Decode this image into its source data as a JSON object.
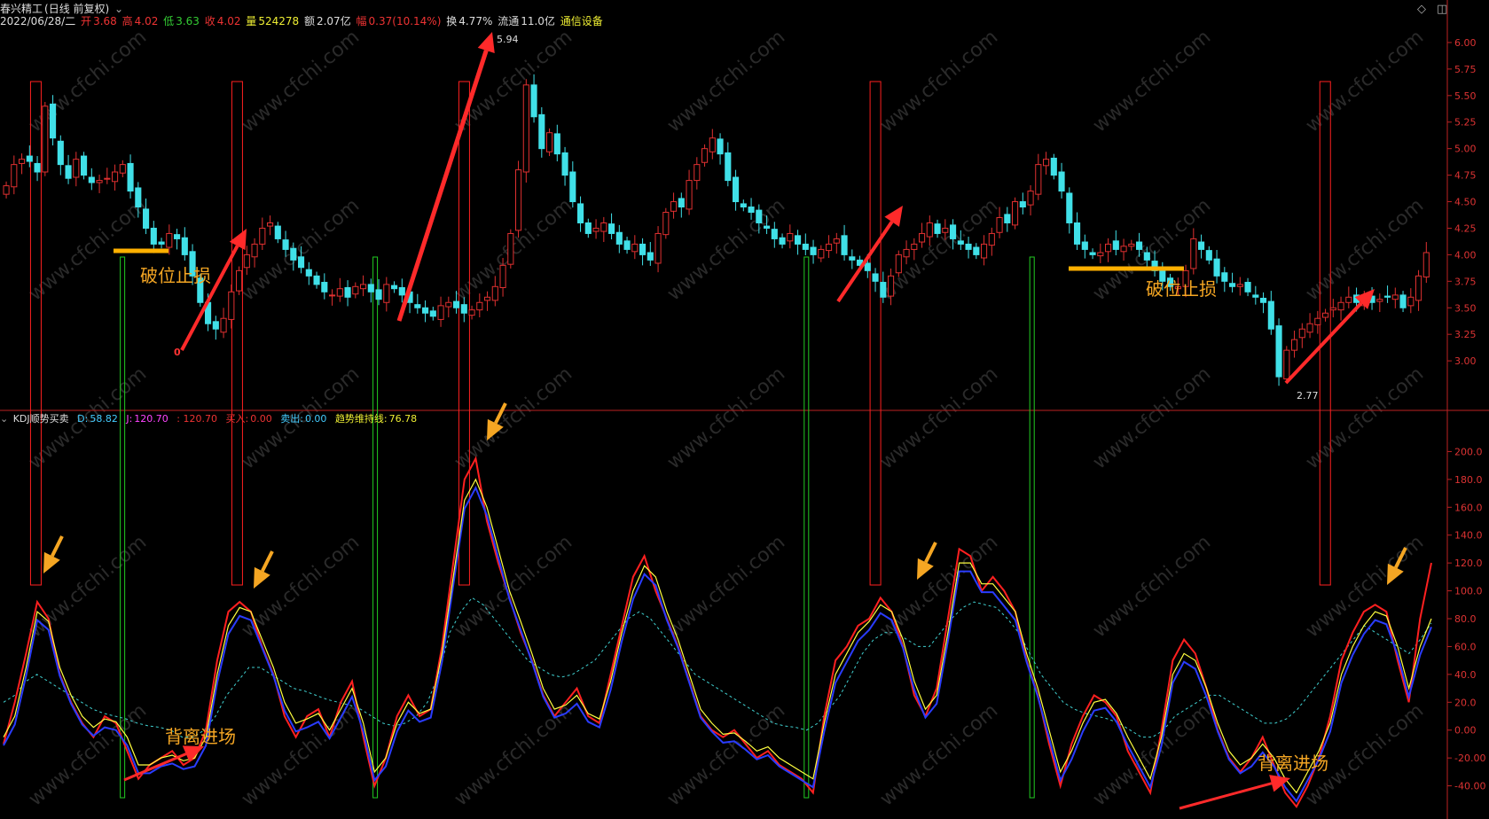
{
  "header": {
    "name": "春兴精工",
    "period": "(日线 前复权)",
    "date": "2022/06/28/二",
    "open_label": "开",
    "open": "3.68",
    "high_label": "高",
    "high": "4.02",
    "low_label": "低",
    "low": "3.63",
    "close_label": "收",
    "close": "4.02",
    "volume_label": "量",
    "volume": "524278",
    "amount_label": "额",
    "amount": "2.07亿",
    "change_label": "幅",
    "change": "0.37(10.14%)",
    "turnover_label": "换",
    "turnover": "4.77%",
    "float_label": "流通",
    "float": "11.0亿",
    "sector": "通信设备"
  },
  "indicator_header": {
    "name": "KDJ顺势买卖",
    "d_label": "D:",
    "d": "58.82",
    "j_label": "J:",
    "j": "120.70",
    "k_text": ": 120.70",
    "buy_label": "买入:",
    "buy": "0.00",
    "sell_label": "卖出:",
    "sell": "0.00",
    "trend_label": "趋势维持线:",
    "trend": "76.78"
  },
  "annotations": {
    "stop_loss_left": "破位止损",
    "stop_loss_right": "破位止损",
    "divergence_left": "背离进场",
    "divergence_right": "背离进场",
    "peak_label": "5.94",
    "trough_label": "2.77",
    "low_marker": "0"
  },
  "watermark": "www.cfchi.com",
  "colors": {
    "up": "#e03030",
    "down": "#40e0e8",
    "k_line": "#e8e8e8",
    "kdj_red": "#ff2020",
    "kdj_blue": "#2a3cff",
    "kdj_yellow": "#ffff40",
    "trend_line": "#40d0d0",
    "arrow": "#ff2a2a",
    "annotation": "#f5a623",
    "axis": "#d33"
  },
  "chart_data": [
    {
      "type": "candlestick",
      "title": "春兴精工 (日线 前复权)",
      "y_ticks": [
        "6.00",
        "5.75",
        "5.50",
        "5.25",
        "5.00",
        "4.75",
        "4.50",
        "4.25",
        "4.00",
        "3.75",
        "3.50",
        "3.25",
        "3.00"
      ],
      "ylim": [
        2.6,
        6.15
      ],
      "close_path": [
        4.65,
        4.85,
        4.9,
        4.88,
        4.78,
        5.4,
        5.1,
        4.85,
        4.72,
        4.9,
        4.75,
        4.68,
        4.7,
        4.72,
        4.78,
        4.85,
        4.6,
        4.45,
        4.25,
        4.1,
        4.1,
        4.2,
        4.15,
        4.0,
        3.8,
        3.55,
        3.35,
        3.3,
        3.4,
        3.65,
        3.85,
        4.0,
        4.1,
        4.25,
        4.3,
        4.15,
        4.05,
        3.95,
        3.88,
        3.8,
        3.72,
        3.65,
        3.62,
        3.68,
        3.6,
        3.7,
        3.72,
        3.65,
        3.58,
        3.72,
        3.68,
        3.62,
        3.55,
        3.5,
        3.45,
        3.42,
        3.52,
        3.55,
        3.5,
        3.45,
        3.48,
        3.55,
        3.6,
        3.7,
        3.9,
        4.2,
        4.8,
        5.6,
        5.3,
        5.0,
        5.15,
        4.95,
        4.75,
        4.5,
        4.3,
        4.2,
        4.25,
        4.3,
        4.2,
        4.1,
        4.05,
        4.1,
        4.0,
        3.95,
        4.2,
        4.4,
        4.5,
        4.45,
        4.7,
        4.85,
        5.0,
        5.1,
        4.95,
        4.7,
        4.5,
        4.45,
        4.4,
        4.3,
        4.25,
        4.15,
        4.1,
        4.2,
        4.1,
        4.05,
        4.0,
        4.05,
        4.1,
        4.15,
        4.0,
        3.95,
        3.9,
        3.85,
        3.75,
        3.6,
        3.8,
        4.0,
        4.05,
        4.1,
        4.2,
        4.3,
        4.2,
        4.25,
        4.15,
        4.1,
        4.05,
        4.0,
        4.1,
        4.2,
        4.35,
        4.3,
        4.5,
        4.45,
        4.6,
        4.85,
        4.9,
        4.75,
        4.6,
        4.3,
        4.1,
        4.05,
        4.0,
        4.02,
        4.1,
        4.05,
        4.08,
        4.1,
        4.05,
        3.95,
        3.85,
        3.75,
        3.7,
        3.7,
        3.85,
        4.15,
        4.05,
        3.95,
        3.8,
        3.75,
        3.7,
        3.72,
        3.65,
        3.6,
        3.55,
        3.3,
        2.85,
        3.1,
        3.2,
        3.3,
        3.35,
        3.4,
        3.45,
        3.5,
        3.55,
        3.6,
        3.55,
        3.62,
        3.55,
        3.58,
        3.6,
        3.62,
        3.5,
        3.6,
        3.8,
        4.02
      ],
      "markers": [
        {
          "label": "5.94",
          "value": 5.94
        },
        {
          "label": "2.77",
          "value": 2.77
        }
      ]
    },
    {
      "type": "line",
      "title": "KDJ顺势买卖",
      "y_ticks": [
        "200.0",
        "180.0",
        "160.0",
        "140.0",
        "120.0",
        "100.0",
        "80.0",
        "60.0",
        "40.0",
        "20.0",
        "0.00",
        "-20.00",
        "-40.00"
      ],
      "ylim": [
        -60,
        220
      ],
      "series": [
        {
          "name": "J",
          "values": [
            -10,
            20,
            55,
            92,
            80,
            40,
            20,
            5,
            -5,
            10,
            5,
            -15,
            -35,
            -25,
            -20,
            -15,
            -25,
            -20,
            0,
            50,
            85,
            92,
            85,
            60,
            40,
            10,
            -5,
            10,
            15,
            -5,
            20,
            35,
            -5,
            -40,
            -20,
            10,
            25,
            10,
            15,
            60,
            120,
            180,
            195,
            150,
            120,
            95,
            70,
            50,
            25,
            10,
            20,
            30,
            10,
            5,
            40,
            75,
            110,
            125,
            100,
            80,
            60,
            35,
            10,
            0,
            -5,
            0,
            -10,
            -20,
            -15,
            -25,
            -30,
            -35,
            -45,
            10,
            50,
            60,
            75,
            80,
            95,
            85,
            60,
            25,
            10,
            30,
            80,
            130,
            125,
            100,
            110,
            100,
            85,
            50,
            25,
            -10,
            -40,
            -10,
            10,
            25,
            20,
            10,
            -15,
            -30,
            -45,
            0,
            50,
            65,
            55,
            30,
            0,
            -20,
            -30,
            -20,
            -5,
            -25,
            -45,
            -55,
            -40,
            -20,
            10,
            50,
            70,
            85,
            90,
            85,
            50,
            20,
            80,
            120
          ]
        },
        {
          "name": "D",
          "values": [
            -5,
            10,
            45,
            85,
            78,
            45,
            25,
            10,
            2,
            8,
            6,
            -5,
            -25,
            -25,
            -20,
            -18,
            -22,
            -20,
            -5,
            40,
            75,
            88,
            85,
            65,
            45,
            20,
            5,
            8,
            12,
            0,
            15,
            30,
            5,
            -30,
            -20,
            5,
            20,
            12,
            15,
            55,
            110,
            165,
            180,
            160,
            130,
            100,
            78,
            55,
            30,
            15,
            18,
            25,
            12,
            8,
            35,
            70,
            100,
            118,
            110,
            85,
            65,
            40,
            15,
            5,
            -3,
            -2,
            -8,
            -15,
            -12,
            -20,
            -25,
            -30,
            -35,
            5,
            40,
            55,
            70,
            78,
            90,
            85,
            65,
            35,
            15,
            25,
            70,
            120,
            120,
            105,
            105,
            95,
            85,
            55,
            30,
            0,
            -30,
            -15,
            5,
            20,
            22,
            12,
            -5,
            -20,
            -35,
            -5,
            40,
            55,
            50,
            30,
            5,
            -15,
            -25,
            -20,
            -10,
            -20,
            -35,
            -45,
            -30,
            -15,
            5,
            40,
            60,
            75,
            85,
            82,
            60,
            30,
            60,
            80
          ]
        },
        {
          "name": "趋势维持线",
          "values": [
            20,
            25,
            35,
            40,
            35,
            30,
            25,
            20,
            15,
            12,
            10,
            8,
            5,
            3,
            2,
            0,
            -5,
            -5,
            0,
            10,
            25,
            35,
            45,
            45,
            40,
            35,
            30,
            28,
            25,
            22,
            20,
            18,
            15,
            10,
            5,
            3,
            5,
            10,
            20,
            40,
            70,
            85,
            95,
            90,
            80,
            70,
            60,
            50,
            45,
            40,
            38,
            40,
            45,
            50,
            60,
            70,
            80,
            85,
            80,
            70,
            60,
            50,
            40,
            35,
            30,
            25,
            20,
            15,
            10,
            5,
            3,
            2,
            0,
            5,
            15,
            25,
            40,
            55,
            65,
            70,
            70,
            65,
            60,
            60,
            70,
            80,
            88,
            92,
            90,
            88,
            80,
            70,
            55,
            40,
            30,
            20,
            15,
            12,
            10,
            8,
            5,
            0,
            -5,
            -5,
            0,
            10,
            15,
            20,
            25,
            25,
            20,
            15,
            10,
            5,
            5,
            8,
            15,
            25,
            35,
            45,
            55,
            65,
            75,
            70,
            65,
            60,
            55,
            65,
            76.78
          ]
        }
      ]
    }
  ]
}
